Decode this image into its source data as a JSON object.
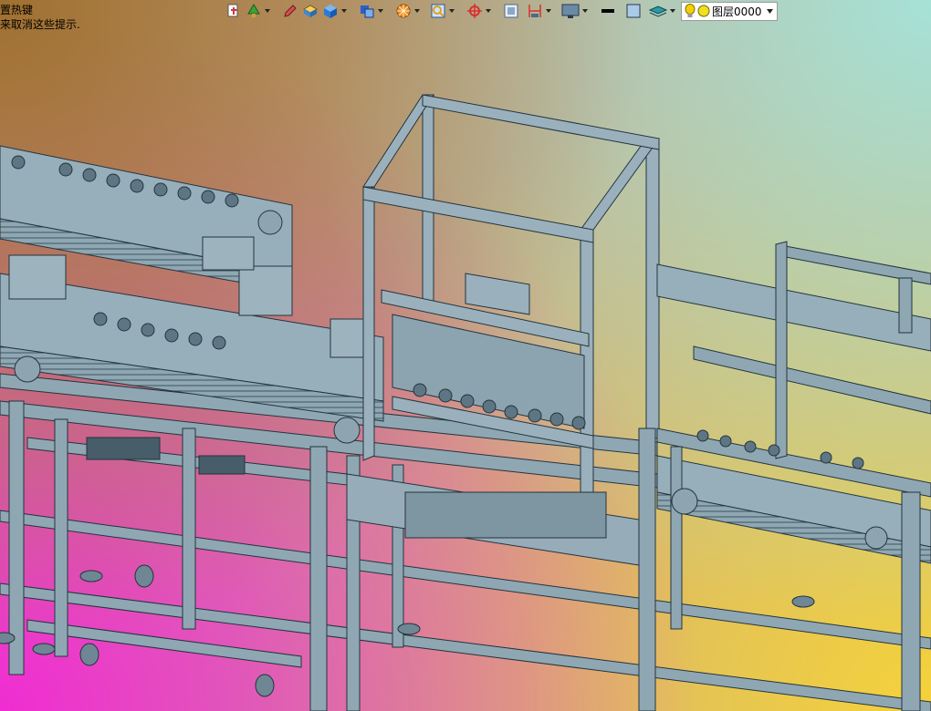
{
  "hint": {
    "line1": "置热键",
    "line2": "来取消这些提示."
  },
  "toolbar": {
    "buttons": [
      {
        "name": "layer-state-icon",
        "color": "#c93a3a"
      },
      {
        "name": "layer-filter-icon",
        "color": "#3aa33a"
      },
      {
        "name": "pencil-icon",
        "color": "#d85050"
      },
      {
        "name": "box-yellow-icon",
        "color": "#e0b030"
      },
      {
        "name": "cube-blue-icon",
        "color": "#2a7ad8"
      },
      {
        "name": "solid-blue-icon",
        "color": "#2a60c8"
      },
      {
        "name": "sun-orange-icon",
        "color": "#f08a20"
      },
      {
        "name": "zoom-window-icon",
        "color": "#e0a020"
      },
      {
        "name": "orbit-icon",
        "color": "#d83030"
      },
      {
        "name": "viewport-icon",
        "color": "#4a6a8a"
      },
      {
        "name": "dimension-icon",
        "color": "#d83030"
      },
      {
        "name": "display-icon",
        "color": "#4a6a8a"
      },
      {
        "name": "line-color-icon",
        "color": "#000000"
      },
      {
        "name": "fill-color-icon",
        "color": "#aacbe8"
      },
      {
        "name": "layer-stack-icon",
        "color": "#2a9aa8"
      }
    ]
  },
  "layer": {
    "name": "图层0000",
    "bulb_color": "#f5d000",
    "sun_color": "#f0e020"
  }
}
